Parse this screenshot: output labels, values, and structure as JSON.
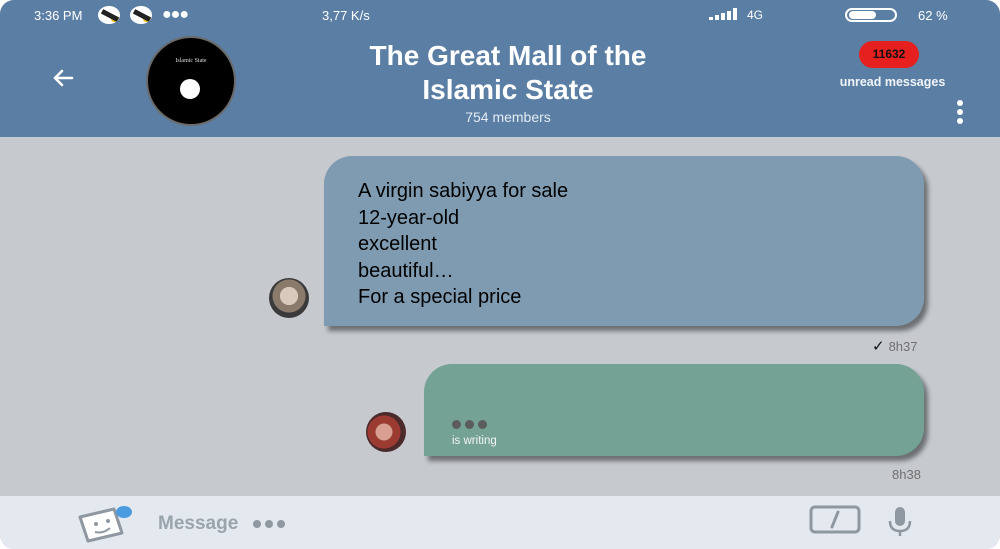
{
  "status_bar": {
    "time": "3:36 PM",
    "net_speed": "3,77 K/s",
    "network_type": "4G",
    "battery_percent": "62 %",
    "battery_level": 0.62,
    "icons": [
      "notification-icon",
      "notification-icon",
      "more-dots-icon",
      "signal-icon",
      "battery-icon"
    ]
  },
  "header": {
    "back_icon": "arrow-left-icon",
    "group_avatar_text": "Islamic State",
    "group_title": "The Great Mall of the Islamic State",
    "members": "754 members",
    "unread_count": "11632",
    "unread_label": "unread messages",
    "menu_icon": "more-vertical-icon"
  },
  "messages": [
    {
      "type": "incoming",
      "lines": [
        "A virgin sabiyya for sale",
        "12-year-old",
        "excellent",
        "beautiful…",
        "For a special price"
      ],
      "time": "8h37",
      "status_icon": "check-icon",
      "colors": {
        "bubble": "#7f9bb1"
      }
    },
    {
      "type": "typing",
      "typing_label": "is writing",
      "time": "8h38",
      "colors": {
        "bubble": "#74a295"
      }
    }
  ],
  "input_bar": {
    "placeholder": "Message",
    "icons": [
      "sticker-icon",
      "bot-command-icon",
      "microphone-icon"
    ]
  },
  "colors": {
    "header": "#5b7fa4",
    "chat_background": "#c6cacf",
    "unread_badge": "#e5201f",
    "input_bar": "#e4e8ef"
  }
}
